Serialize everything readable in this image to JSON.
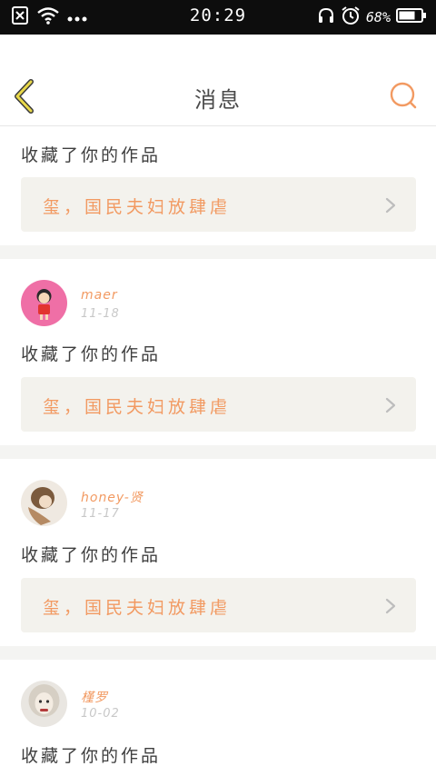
{
  "status_bar": {
    "time": "20:29",
    "battery": "68%",
    "icons": [
      "sim-off-icon",
      "wifi-icon",
      "more-dots-icon",
      "headphones-icon",
      "alarm-icon",
      "battery-icon"
    ]
  },
  "header": {
    "title": "消息",
    "back_icon": "chevron-left-icon",
    "search_icon": "search-icon"
  },
  "colors": {
    "accent": "#f29a62",
    "back_arrow": "#e8d84a",
    "card_bg": "#f3f2ed",
    "divider": "#f4f4f2"
  },
  "notifications": [
    {
      "username": "",
      "date": "",
      "action": "收藏了你的作品",
      "work_title": "玺，国民夫妇放肆虐"
    },
    {
      "username": "maer",
      "date": "11-18",
      "action": "收藏了你的作品",
      "work_title": "玺，国民夫妇放肆虐"
    },
    {
      "username": "honey-贤",
      "date": "11-17",
      "action": "收藏了你的作品",
      "work_title": "玺，国民夫妇放肆虐"
    },
    {
      "username": "槿罗",
      "date": "10-02",
      "action": "收藏了你的作品",
      "work_title": ""
    }
  ]
}
